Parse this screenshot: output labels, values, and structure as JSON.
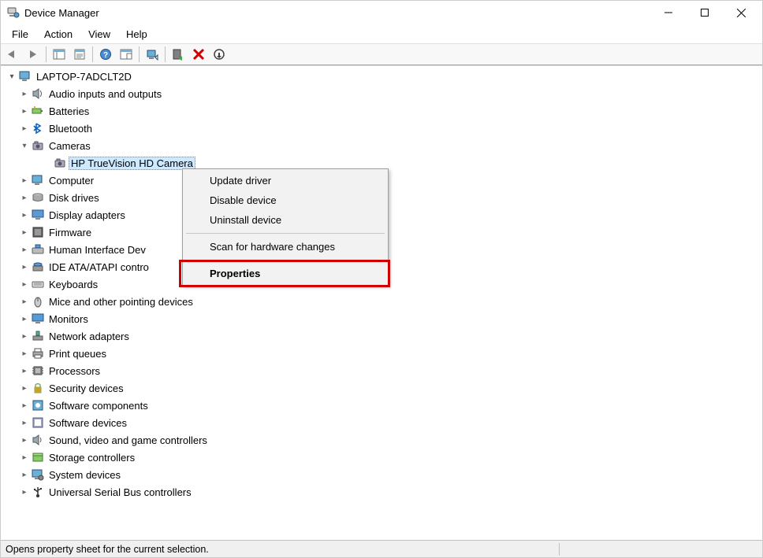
{
  "window": {
    "title": "Device Manager"
  },
  "menubar": [
    "File",
    "Action",
    "View",
    "Help"
  ],
  "tree": {
    "root": "LAPTOP-7ADCLT2D",
    "categories": [
      {
        "label": "Audio inputs and outputs",
        "icon": "speaker"
      },
      {
        "label": "Batteries",
        "icon": "battery"
      },
      {
        "label": "Bluetooth",
        "icon": "bluetooth"
      },
      {
        "label": "Cameras",
        "icon": "camera",
        "expanded": true,
        "children": [
          {
            "label": "HP TrueVision HD Camera",
            "icon": "camera",
            "selected": true
          }
        ]
      },
      {
        "label": "Computer",
        "icon": "computer"
      },
      {
        "label": "Disk drives",
        "icon": "disk"
      },
      {
        "label": "Display adapters",
        "icon": "display"
      },
      {
        "label": "Firmware",
        "icon": "firmware"
      },
      {
        "label": "Human Interface Devices",
        "icon": "hid",
        "truncated": "Human Interface Dev"
      },
      {
        "label": "IDE ATA/ATAPI controllers",
        "icon": "ide",
        "truncated": "IDE ATA/ATAPI contro"
      },
      {
        "label": "Keyboards",
        "icon": "keyboard"
      },
      {
        "label": "Mice and other pointing devices",
        "icon": "mouse"
      },
      {
        "label": "Monitors",
        "icon": "monitor"
      },
      {
        "label": "Network adapters",
        "icon": "network"
      },
      {
        "label": "Print queues",
        "icon": "printer"
      },
      {
        "label": "Processors",
        "icon": "cpu"
      },
      {
        "label": "Security devices",
        "icon": "security"
      },
      {
        "label": "Software components",
        "icon": "swcomp"
      },
      {
        "label": "Software devices",
        "icon": "swdev"
      },
      {
        "label": "Sound, video and game controllers",
        "icon": "sound"
      },
      {
        "label": "Storage controllers",
        "icon": "storage"
      },
      {
        "label": "System devices",
        "icon": "system"
      },
      {
        "label": "Universal Serial Bus controllers",
        "icon": "usb"
      }
    ]
  },
  "context_menu": {
    "items": [
      "Update driver",
      "Disable device",
      "Uninstall device",
      "__sep__",
      "Scan for hardware changes",
      "__sep__",
      "Properties"
    ],
    "bold_item": "Properties",
    "highlighted_item": "Properties"
  },
  "statusbar": {
    "text": "Opens property sheet for the current selection."
  },
  "toolbar": [
    "back",
    "forward",
    "__sep__",
    "show-hide-console-tree",
    "properties-sheet",
    "__sep__",
    "help",
    "action-list",
    "__sep__",
    "update-driver",
    "__sep__",
    "enable-device",
    "uninstall-device",
    "scan-hardware"
  ]
}
